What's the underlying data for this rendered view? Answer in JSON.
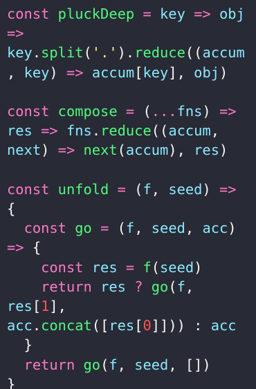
{
  "theme": {
    "background": "#282a36",
    "keyword": "#ff79c6",
    "function": "#50fa7b",
    "identifier": "#8be9fd",
    "punctuation": "#f8f8f2",
    "string": "#f1fa8c",
    "number": "#ff5555"
  },
  "code_lines": [
    [
      [
        "k",
        "const"
      ],
      [
        "p",
        " "
      ],
      [
        "f",
        "pluckDeep"
      ],
      [
        "p",
        " "
      ],
      [
        "k",
        "="
      ],
      [
        "p",
        " "
      ],
      [
        "i",
        "key"
      ],
      [
        "p",
        " "
      ],
      [
        "k",
        "=>"
      ],
      [
        "p",
        " "
      ],
      [
        "i",
        "obj"
      ]
    ],
    [
      [
        "k",
        "=>"
      ]
    ],
    [
      [
        "i",
        "key"
      ],
      [
        "p",
        "."
      ],
      [
        "f",
        "split"
      ],
      [
        "p",
        "("
      ],
      [
        "s",
        "'.'"
      ],
      [
        "p",
        ")."
      ],
      [
        "f",
        "reduce"
      ],
      [
        "p",
        "(("
      ],
      [
        "i",
        "accum"
      ]
    ],
    [
      [
        "p",
        ", "
      ],
      [
        "i",
        "key"
      ],
      [
        "p",
        ") "
      ],
      [
        "k",
        "=>"
      ],
      [
        "p",
        " "
      ],
      [
        "i",
        "accum"
      ],
      [
        "p",
        "["
      ],
      [
        "i",
        "key"
      ],
      [
        "p",
        "], "
      ],
      [
        "i",
        "obj"
      ],
      [
        "p",
        ")"
      ]
    ],
    [],
    [
      [
        "k",
        "const"
      ],
      [
        "p",
        " "
      ],
      [
        "f",
        "compose"
      ],
      [
        "p",
        " "
      ],
      [
        "k",
        "="
      ],
      [
        "p",
        " ("
      ],
      [
        "k",
        "..."
      ],
      [
        "i",
        "fns"
      ],
      [
        "p",
        ") "
      ],
      [
        "k",
        "=>"
      ]
    ],
    [
      [
        "i",
        "res"
      ],
      [
        "p",
        " "
      ],
      [
        "k",
        "=>"
      ],
      [
        "p",
        " "
      ],
      [
        "i",
        "fns"
      ],
      [
        "p",
        "."
      ],
      [
        "f",
        "reduce"
      ],
      [
        "p",
        "(("
      ],
      [
        "i",
        "accum"
      ],
      [
        "p",
        ","
      ]
    ],
    [
      [
        "i",
        "next"
      ],
      [
        "p",
        ") "
      ],
      [
        "k",
        "=>"
      ],
      [
        "p",
        " "
      ],
      [
        "f",
        "next"
      ],
      [
        "p",
        "("
      ],
      [
        "i",
        "accum"
      ],
      [
        "p",
        "), "
      ],
      [
        "i",
        "res"
      ],
      [
        "p",
        ")"
      ]
    ],
    [],
    [
      [
        "k",
        "const"
      ],
      [
        "p",
        " "
      ],
      [
        "f",
        "unfold"
      ],
      [
        "p",
        " "
      ],
      [
        "k",
        "="
      ],
      [
        "p",
        " ("
      ],
      [
        "i",
        "f"
      ],
      [
        "p",
        ", "
      ],
      [
        "i",
        "seed"
      ],
      [
        "p",
        ") "
      ],
      [
        "k",
        "=>"
      ]
    ],
    [
      [
        "p",
        "{"
      ]
    ],
    [
      [
        "p",
        "  "
      ],
      [
        "k",
        "const"
      ],
      [
        "p",
        " "
      ],
      [
        "f",
        "go"
      ],
      [
        "p",
        " "
      ],
      [
        "k",
        "="
      ],
      [
        "p",
        " ("
      ],
      [
        "i",
        "f"
      ],
      [
        "p",
        ", "
      ],
      [
        "i",
        "seed"
      ],
      [
        "p",
        ", "
      ],
      [
        "i",
        "acc"
      ],
      [
        "p",
        ")"
      ]
    ],
    [
      [
        "k",
        "=>"
      ],
      [
        "p",
        " {"
      ]
    ],
    [
      [
        "p",
        "    "
      ],
      [
        "k",
        "const"
      ],
      [
        "p",
        " "
      ],
      [
        "i",
        "res"
      ],
      [
        "p",
        " "
      ],
      [
        "k",
        "="
      ],
      [
        "p",
        " "
      ],
      [
        "f",
        "f"
      ],
      [
        "p",
        "("
      ],
      [
        "i",
        "seed"
      ],
      [
        "p",
        ")"
      ]
    ],
    [
      [
        "p",
        "    "
      ],
      [
        "k",
        "return"
      ],
      [
        "p",
        " "
      ],
      [
        "i",
        "res"
      ],
      [
        "p",
        " "
      ],
      [
        "k",
        "?"
      ],
      [
        "p",
        " "
      ],
      [
        "f",
        "go"
      ],
      [
        "p",
        "("
      ],
      [
        "i",
        "f"
      ],
      [
        "p",
        ","
      ]
    ],
    [
      [
        "i",
        "res"
      ],
      [
        "p",
        "["
      ],
      [
        "n",
        "1"
      ],
      [
        "p",
        "],"
      ]
    ],
    [
      [
        "i",
        "acc"
      ],
      [
        "p",
        "."
      ],
      [
        "f",
        "concat"
      ],
      [
        "p",
        "(["
      ],
      [
        "i",
        "res"
      ],
      [
        "p",
        "["
      ],
      [
        "n",
        "0"
      ],
      [
        "p",
        "]])) : "
      ],
      [
        "i",
        "acc"
      ]
    ],
    [
      [
        "p",
        "  }"
      ]
    ],
    [
      [
        "p",
        "  "
      ],
      [
        "k",
        "return"
      ],
      [
        "p",
        " "
      ],
      [
        "f",
        "go"
      ],
      [
        "p",
        "("
      ],
      [
        "i",
        "f"
      ],
      [
        "p",
        ", "
      ],
      [
        "i",
        "seed"
      ],
      [
        "p",
        ", [])"
      ]
    ],
    [
      [
        "p",
        "}"
      ]
    ]
  ]
}
